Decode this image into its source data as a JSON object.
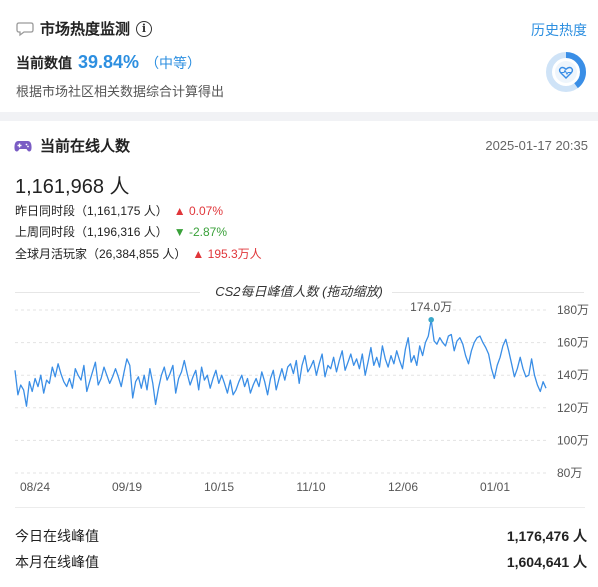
{
  "heat": {
    "title": "市场热度监测",
    "history_label": "历史热度",
    "current_label": "当前数值",
    "current_value": "39.84%",
    "level": "（中等）",
    "description": "根据市场社区相关数据综合计算得出",
    "gauge_fraction": 0.3984,
    "accent": "#2d8fe0"
  },
  "online": {
    "title": "当前在线人数",
    "timestamp": "2025-01-17 20:35",
    "count": "1,161,968 人",
    "comparisons": [
      {
        "label": "昨日同时段（1,161,175 人）",
        "arrow": "▲",
        "change": "0.07%",
        "direction": "up"
      },
      {
        "label": "上周同时段（1,196,316 人）",
        "arrow": "▼",
        "change": "-2.87%",
        "direction": "down"
      },
      {
        "label": "全球月活玩家（26,384,855 人）",
        "arrow": "▲",
        "change": "195.3万人",
        "direction": "up"
      }
    ]
  },
  "chart_data": {
    "type": "line",
    "title": "CS2每日峰值人数 (拖动缩放)",
    "unit": "万",
    "ylim": [
      80,
      180
    ],
    "yticks": [
      "80万",
      "100万",
      "120万",
      "140万",
      "160万",
      "180万"
    ],
    "xticks": [
      "08/24",
      "09/19",
      "10/15",
      "11/10",
      "12/06",
      "01/01"
    ],
    "peak_label": "174.0万",
    "peak_value": 174.0,
    "line_color": "#3a8ee6",
    "series": [
      {
        "values": [
          143,
          128,
          134,
          131,
          121,
          136,
          130,
          138,
          133,
          140,
          129,
          137,
          135,
          145,
          139,
          147,
          141,
          136,
          133,
          138,
          132,
          144,
          140,
          137,
          146,
          130,
          136,
          142,
          148,
          134,
          138,
          145,
          140,
          135,
          139,
          144,
          139,
          133,
          142,
          150,
          146,
          126,
          136,
          139,
          132,
          140,
          131,
          144,
          135,
          122,
          132,
          140,
          145,
          137,
          141,
          146,
          129,
          138,
          142,
          149,
          141,
          134,
          139,
          143,
          131,
          145,
          137,
          140,
          132,
          138,
          143,
          135,
          140,
          135,
          129,
          137,
          128,
          131,
          136,
          140,
          133,
          138,
          129,
          134,
          138,
          133,
          142,
          136,
          128,
          138,
          143,
          131,
          138,
          144,
          137,
          145,
          147,
          141,
          149,
          135,
          146,
          152,
          142,
          145,
          149,
          140,
          147,
          153,
          139,
          146,
          144,
          151,
          142,
          149,
          155,
          143,
          148,
          153,
          146,
          150,
          144,
          153,
          140,
          148,
          157,
          146,
          151,
          145,
          158,
          150,
          145,
          152,
          147,
          155,
          149,
          144,
          156,
          163,
          148,
          152,
          146,
          158,
          152,
          160,
          164,
          174,
          161,
          159,
          163,
          160,
          158,
          164,
          165,
          155,
          161,
          163,
          159,
          152,
          147,
          155,
          160,
          163,
          164,
          160,
          157,
          153,
          144,
          138,
          146,
          151,
          158,
          162,
          155,
          147,
          139,
          144,
          151,
          144,
          139,
          140,
          150,
          140,
          134,
          130,
          136,
          132
        ]
      }
    ]
  },
  "peaks": [
    {
      "label": "今日在线峰值",
      "value": "1,176,476 人"
    },
    {
      "label": "本月在线峰值",
      "value": "1,604,641 人"
    }
  ]
}
